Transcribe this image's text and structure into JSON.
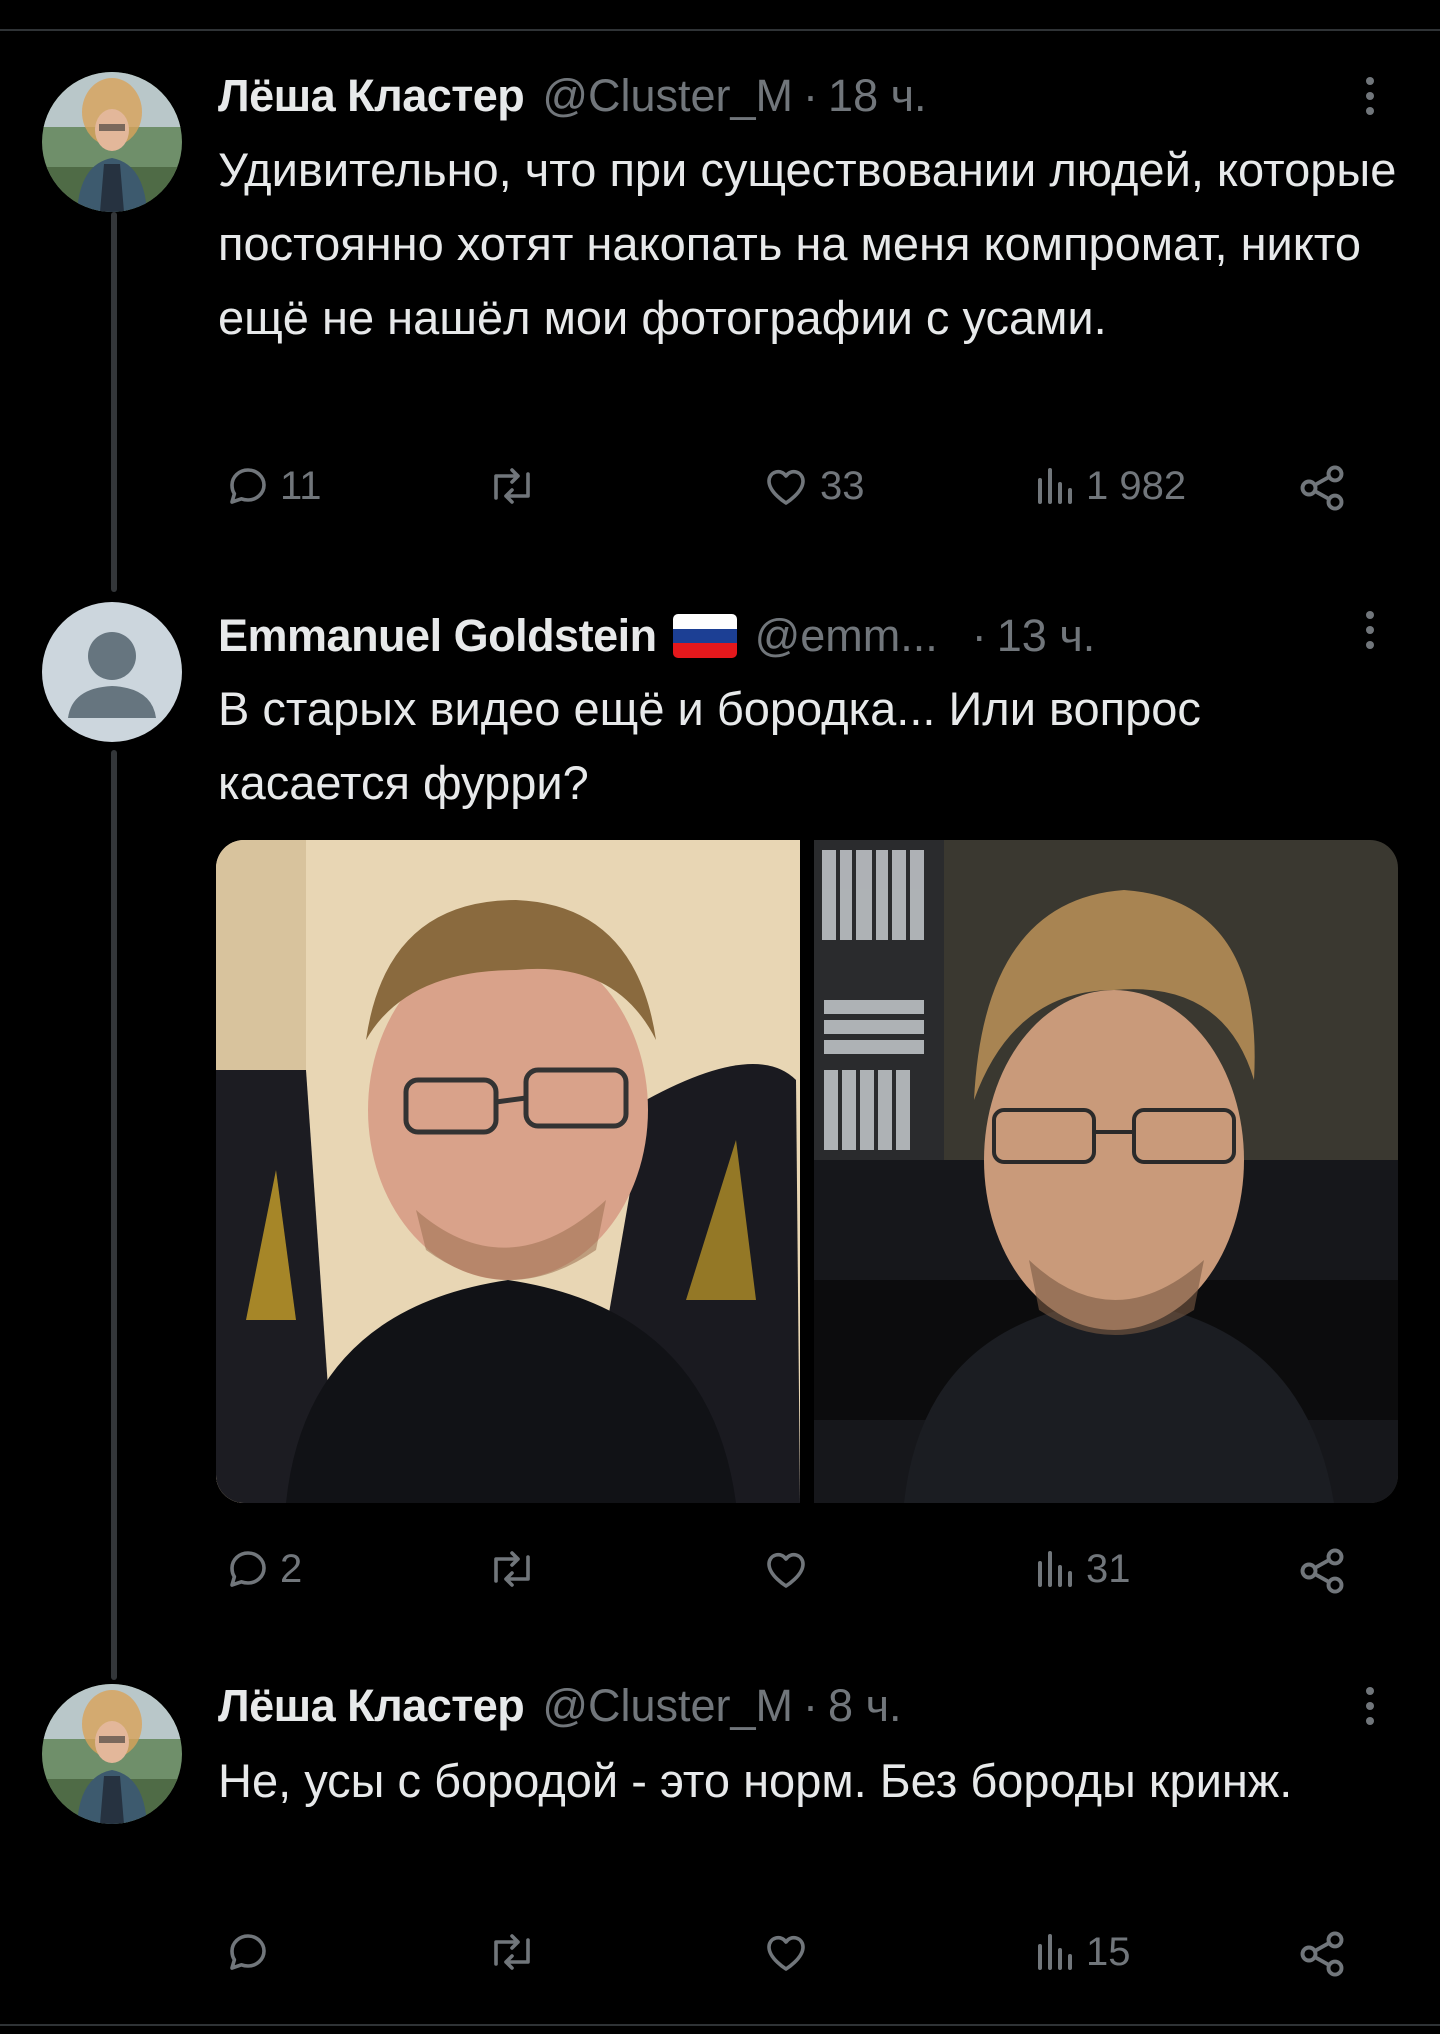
{
  "tweets": [
    {
      "name": "Лёша Кластер",
      "handle": "@Cluster_M",
      "dot": "·",
      "time": "18 ч.",
      "text": "Удивительно, что при существовании людей, которые постоянно хотят накопать на меня компромат, никто ещё не нашёл мои фотографии с усами.",
      "replies": "11",
      "retweets": "",
      "likes": "33",
      "views": "1 982"
    },
    {
      "name": "Emmanuel Goldstein",
      "handle": "@emm...",
      "dot": "·",
      "time": "13 ч.",
      "text": "В старых видео ещё и бородка... Или вопрос касается фурри?",
      "replies": "2",
      "retweets": "",
      "likes": "",
      "views": "31"
    },
    {
      "name": "Лёша Кластер",
      "handle": "@Cluster_M",
      "dot": "·",
      "time": "8 ч.",
      "text": "Не, усы с бородой - это норм. Без бороды кринж.",
      "replies": "",
      "retweets": "",
      "likes": "",
      "views": "15"
    }
  ],
  "icons": {
    "reply": "speech-bubble",
    "retweet": "two-arrows-loop",
    "like": "heart",
    "views": "bar-chart",
    "share": "share-nodes",
    "more": "vertical-ellipsis",
    "flag": "russia-flag"
  },
  "colors": {
    "background": "#000000",
    "text": "#e7e9ea",
    "muted": "#71767b",
    "thread_line": "#333639",
    "flag_white": "#ffffff",
    "flag_blue": "#1c3f94",
    "flag_red": "#e4181c"
  }
}
